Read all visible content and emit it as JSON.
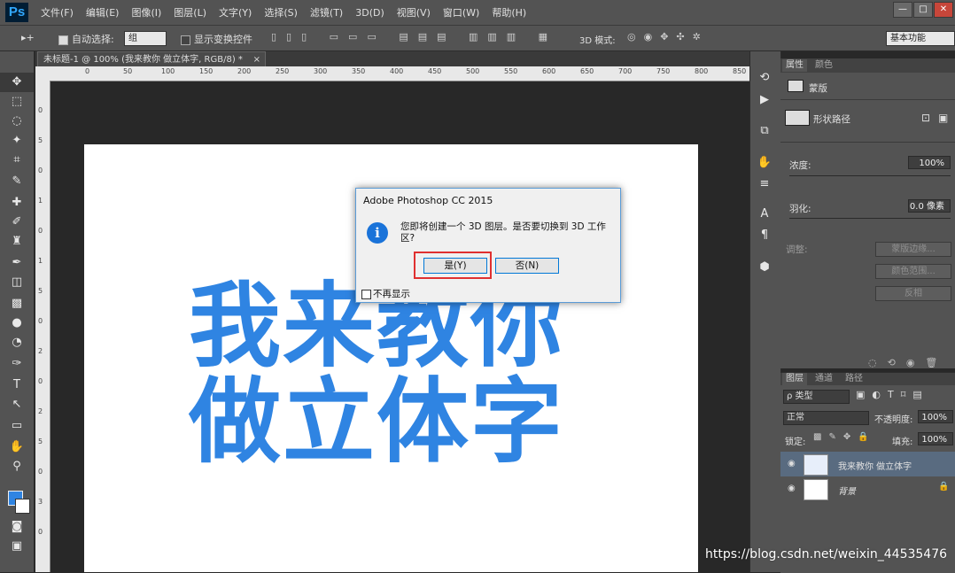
{
  "app": {
    "logo": "Ps",
    "menu": [
      "文件(F)",
      "编辑(E)",
      "图像(I)",
      "图层(L)",
      "文字(Y)",
      "选择(S)",
      "滤镜(T)",
      "3D(D)",
      "视图(V)",
      "窗口(W)",
      "帮助(H)"
    ],
    "window_buttons": [
      "—",
      "□",
      "✕"
    ]
  },
  "options_bar": {
    "move_tool_glyph": "▸+",
    "auto_select_label": "自动选择:",
    "auto_select_value": "组",
    "show_transform_label": "显示变换控件",
    "mode_3d_label": "3D 模式:",
    "workspace": "基本功能"
  },
  "document_tab": {
    "title": "未标题-1 @ 100% (我来教你 做立体字, RGB/8) *",
    "close": "×"
  },
  "ruler": {
    "h_ticks": [
      "0",
      "50",
      "100",
      "150",
      "200",
      "250",
      "300",
      "350",
      "400",
      "450",
      "500",
      "550",
      "600",
      "650",
      "700",
      "750",
      "800",
      "850"
    ],
    "v_ticks": [
      "0",
      "5",
      "0",
      "1",
      "0",
      "1",
      "5",
      "0",
      "2",
      "0",
      "2",
      "5",
      "0",
      "3",
      "0"
    ]
  },
  "canvas": {
    "line1": "我来教你",
    "line2": "做立体字",
    "text_color": "#2f84e2"
  },
  "dialog": {
    "title": "Adobe Photoshop CC 2015",
    "icon": "i",
    "message": "您即将创建一个 3D 图层。是否要切换到 3D 工作区?",
    "yes": "是(Y)",
    "no": "否(N)",
    "dont_show": "不再显示"
  },
  "properties_panel": {
    "tabs": [
      "属性",
      "颜色"
    ],
    "mask_label": "蒙版",
    "vector_label": "形状路径",
    "density_label": "浓度:",
    "density_value": "100%",
    "feather_label": "羽化:",
    "feather_value": "0.0 像素",
    "adjust_label": "调整:",
    "buttons": [
      "蒙版边缘...",
      "颜色范围...",
      "反相"
    ]
  },
  "layers_panel": {
    "tabs": [
      "图层",
      "通道",
      "路径"
    ],
    "filter": "ρ 类型",
    "blend_mode": "正常",
    "opacity_label": "不透明度:",
    "opacity_value": "100%",
    "lock_label": "锁定:",
    "fill_label": "填充:",
    "fill_value": "100%",
    "layers": [
      {
        "name": "我来教你 做立体字"
      },
      {
        "name": "背景"
      }
    ]
  },
  "watermark": "https://blog.csdn.net/weixin_44535476"
}
